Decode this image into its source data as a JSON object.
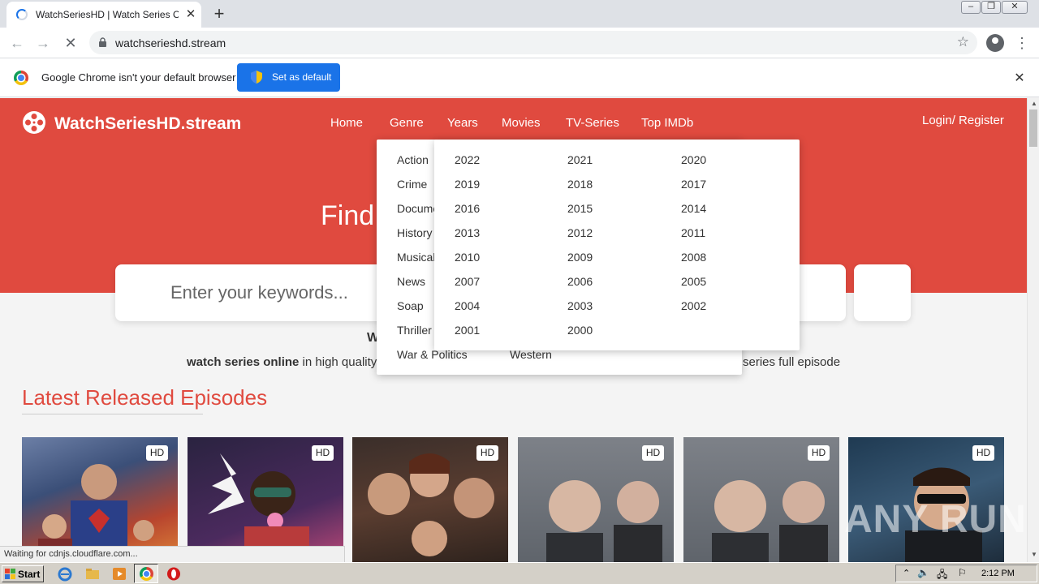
{
  "browser": {
    "tab_title": "WatchSeriesHD | Watch Series Onlin",
    "url": "watchserieshd.stream",
    "infobar_text": "Google Chrome isn't your default browser",
    "set_default_label": "Set as default"
  },
  "site": {
    "name": "WatchSeriesHD.stream",
    "nav": [
      "Home",
      "Genre",
      "Years",
      "Movies",
      "TV-Series",
      "Top IMDb"
    ],
    "login": "Login/ Register",
    "hero_title": "Find",
    "search_placeholder": "Enter your keywords...",
    "tag_heading_partial": "W",
    "tagline_bold": "watch series online",
    "tagline_left_rest": " in high quality",
    "tagline_right": "series full episode",
    "latest_title": "Latest Released Episodes",
    "hd_badge": "HD"
  },
  "genre_menu": {
    "left": [
      "Action",
      "Crime",
      "Documentary",
      "History",
      "Musical",
      "News",
      "Soap",
      "Thriller",
      "War & Politics"
    ],
    "right_visible": [
      "Western"
    ]
  },
  "years_menu": {
    "col1": [
      "2022",
      "2019",
      "2016",
      "2013",
      "2010",
      "2007",
      "2004",
      "2001"
    ],
    "col2": [
      "2021",
      "2018",
      "2015",
      "2012",
      "2009",
      "2006",
      "2003",
      "2000"
    ],
    "col3": [
      "2020",
      "2017",
      "2014",
      "2011",
      "2008",
      "2005",
      "2002"
    ]
  },
  "status_text": "Waiting for cdnjs.cloudflare.com...",
  "watermark": "ANY RUN",
  "taskbar": {
    "start_label": "Start",
    "clock": "2:12 PM"
  },
  "colors": {
    "brand_red": "#e04a3f",
    "chrome_blue": "#1a73e8"
  }
}
